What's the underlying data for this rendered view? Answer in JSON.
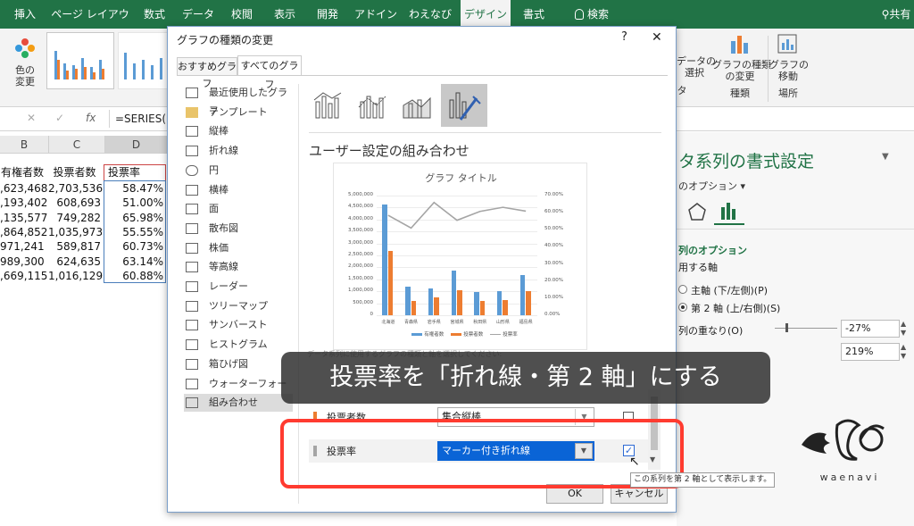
{
  "ribbon": {
    "tabs": [
      "挿入",
      "ページ レイアウト",
      "数式",
      "データ",
      "校閲",
      "表示",
      "開発",
      "アドイン",
      "わえなび",
      "デザイン",
      "書式"
    ],
    "search": "検索",
    "share": "共有",
    "color_button": "色の\n変更",
    "data_select": "データの\n選択",
    "change_chart_type": "グラフの種類\nの変更",
    "move_chart": "グラフの\n移動",
    "group_type": "種類",
    "group_location": "場所",
    "group_data": "タ"
  },
  "formula_bar": {
    "formula": "=SERIES(",
    "fx": "fx"
  },
  "sheet": {
    "columns": [
      "B",
      "C",
      "D"
    ],
    "headers": [
      "有権者数",
      "投票者数",
      "投票率"
    ],
    "rows": [
      [
        ",623,468",
        "2,703,536",
        "58.47%"
      ],
      [
        ",193,402",
        "608,693",
        "51.00%"
      ],
      [
        ",135,577",
        "749,282",
        "65.98%"
      ],
      [
        ",864,852",
        "1,035,973",
        "55.55%"
      ],
      [
        "971,241",
        "589,817",
        "60.73%"
      ],
      [
        "989,300",
        "624,635",
        "63.14%"
      ],
      [
        ",669,115",
        "1,016,129",
        "60.88%"
      ]
    ]
  },
  "pane": {
    "title": "タ系列の書式設定",
    "options_label": "のオプション ▾",
    "series_options": "列のオプション",
    "axis_label": "用する軸",
    "primary_axis": "主軸 (下/左側)(P)",
    "secondary_axis": "第 2 軸 (上/右側)(S)",
    "overlap_label": "列の重なり(O)",
    "overlap_value": "-27%",
    "gap_value": "219%"
  },
  "dialog": {
    "title": "グラフの種類の変更",
    "help": "?",
    "close": "✕",
    "tabs": [
      "おすすめグラフ",
      "すべてのグラフ"
    ],
    "sidebar": [
      "最近使用したグラフ",
      "テンプレート",
      "縦棒",
      "折れ線",
      "円",
      "横棒",
      "面",
      "散布図",
      "株価",
      "等高線",
      "レーダー",
      "ツリーマップ",
      "サンバースト",
      "ヒストグラム",
      "箱ひげ図",
      "ウォーターフォール",
      "組み合わせ"
    ],
    "section_title": "ユーザー設定の組み合わせ",
    "note": "データ系列に使用するグラフの種類と軸を選択してください:",
    "series_rows": [
      {
        "name": "投票者数",
        "type": "集合縦棒",
        "secondary": false
      },
      {
        "name": "投票率",
        "type": "マーカー付き折れ線",
        "secondary": true
      }
    ],
    "ok": "OK",
    "cancel": "キャンセル",
    "tooltip": "この系列を第 2 軸として表示します。"
  },
  "chart_data": {
    "type": "bar",
    "title": "グラフ タイトル",
    "categories": [
      "北海道",
      "青森県",
      "岩手県",
      "宮城県",
      "秋田県",
      "山形県",
      "福島県"
    ],
    "series": [
      {
        "name": "有権者数",
        "kind": "bar",
        "axis": "primary",
        "color": "#5b9bd5",
        "values": [
          4623468,
          1193402,
          1135577,
          1864852,
          971241,
          989300,
          1669115
        ]
      },
      {
        "name": "投票者数",
        "kind": "bar",
        "axis": "primary",
        "color": "#ed7d31",
        "values": [
          2703536,
          608693,
          749282,
          1035973,
          589817,
          624635,
          1016129
        ]
      },
      {
        "name": "投票率",
        "kind": "line",
        "axis": "secondary",
        "color": "#a5a5a5",
        "values": [
          58.47,
          51.0,
          65.98,
          55.55,
          60.73,
          63.14,
          60.88
        ]
      }
    ],
    "y_ticks": [
      "5,000,000",
      "4,500,000",
      "4,000,000",
      "3,500,000",
      "3,000,000",
      "2,500,000",
      "2,000,000",
      "1,500,000",
      "1,000,000",
      "500,000",
      "0"
    ],
    "y2_ticks": [
      "70.00%",
      "60.00%",
      "50.00%",
      "40.00%",
      "30.00%",
      "20.00%",
      "10.00%",
      "0.00%"
    ],
    "ylim": [
      0,
      5000000
    ],
    "y2lim": [
      0,
      70
    ]
  },
  "caption": "投票率を「折れ線・第 2 軸」にする",
  "watermark": "waenavi",
  "colors": {
    "excel_green": "#217346",
    "highlight_red": "#ff3b30",
    "select_blue": "#0a64d6"
  }
}
